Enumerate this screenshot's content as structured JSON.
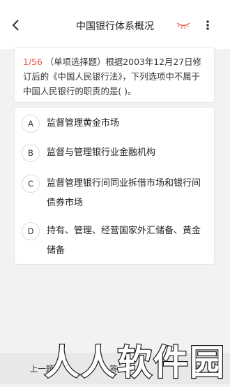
{
  "header": {
    "title": "中国银行体系概况"
  },
  "question": {
    "number": "1/56",
    "type": "（单项选择题）",
    "text": "根据2003年12月27日修订后的《中国人民银行法》，下列选项中不属于中国人民银行的职责的是( )。"
  },
  "options": [
    {
      "letter": "A",
      "text": "监督管理黄金市场"
    },
    {
      "letter": "B",
      "text": "监督与管理银行业金融机构"
    },
    {
      "letter": "C",
      "text": "监督管理银行间同业拆借市场和银行间债券市场"
    },
    {
      "letter": "D",
      "text": "持有、管理、经营国家外汇储备、黄金储备"
    }
  ],
  "bottom": {
    "prev_label": "上一题",
    "middle_label": "答",
    "next_label": "题"
  },
  "watermark": {
    "text": "人人软件园"
  },
  "colors": {
    "accent": "#e7513f"
  }
}
